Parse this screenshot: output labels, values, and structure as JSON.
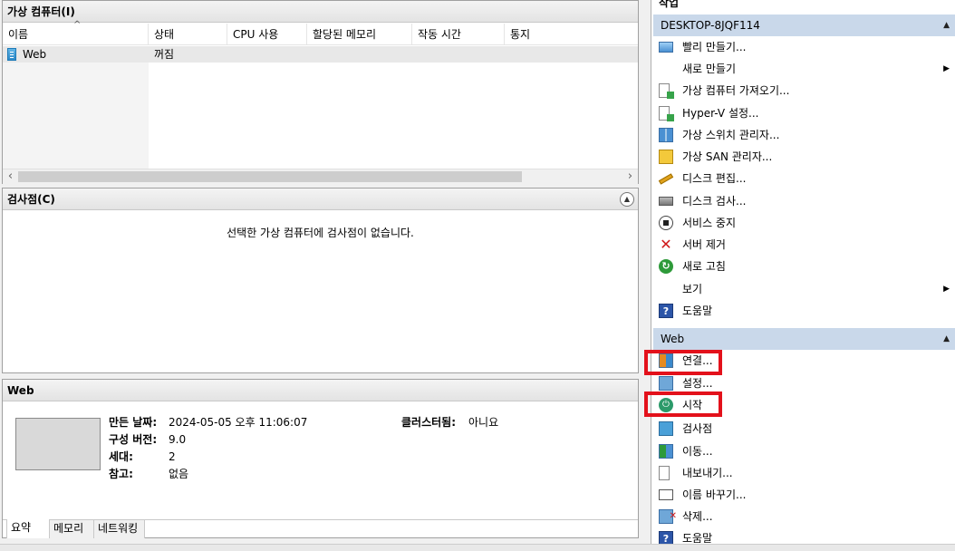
{
  "vm_panel": {
    "title": "가상 컴퓨터(I)",
    "columns": [
      "이름",
      "상태",
      "CPU 사용",
      "할당된 메모리",
      "작동 시간",
      "통지"
    ],
    "rows": [
      {
        "name": "Web",
        "state": "꺼짐"
      }
    ]
  },
  "checkpoint_panel": {
    "title": "검사점(C)",
    "empty_message": "선택한 가상 컴퓨터에 검사점이 없습니다."
  },
  "detail_panel": {
    "title": "Web",
    "created_label": "만든 날짜:",
    "created_value": "2024-05-05 오후 11:06:07",
    "config_label": "구성 버전:",
    "config_value": "9.0",
    "generation_label": "세대:",
    "generation_value": "2",
    "notes_label": "참고:",
    "notes_value": "없음",
    "clustered_label": "클러스터됨:",
    "clustered_value": "아니요",
    "tabs": [
      "요약",
      "메모리",
      "네트워킹"
    ]
  },
  "actions": {
    "title": "작업",
    "host_section": {
      "title": "DESKTOP-8JQF114",
      "items": [
        {
          "label": "빨리 만들기...",
          "icon": "quick-create-icon"
        },
        {
          "label": "새로 만들기",
          "icon": "none",
          "submenu": true
        },
        {
          "label": "가상 컴퓨터 가져오기...",
          "icon": "import-vm-icon"
        },
        {
          "label": "Hyper-V 설정...",
          "icon": "hyperv-settings-icon"
        },
        {
          "label": "가상 스위치 관리자...",
          "icon": "virtual-switch-icon"
        },
        {
          "label": "가상 SAN 관리자...",
          "icon": "virtual-san-icon"
        },
        {
          "label": "디스크 편집...",
          "icon": "edit-disk-icon"
        },
        {
          "label": "디스크 검사...",
          "icon": "inspect-disk-icon"
        },
        {
          "label": "서비스 중지",
          "icon": "stop-service-icon"
        },
        {
          "label": "서버 제거",
          "icon": "remove-server-icon"
        },
        {
          "label": "새로 고침",
          "icon": "refresh-icon"
        },
        {
          "label": "보기",
          "icon": "none",
          "submenu": true
        },
        {
          "label": "도움말",
          "icon": "help-icon"
        }
      ]
    },
    "vm_section": {
      "title": "Web",
      "items": [
        {
          "label": "연결...",
          "icon": "connect-icon",
          "highlighted": true
        },
        {
          "label": "설정...",
          "icon": "vm-settings-icon"
        },
        {
          "label": "시작",
          "icon": "start-icon",
          "highlighted": true
        },
        {
          "label": "검사점",
          "icon": "checkpoint-icon"
        },
        {
          "label": "이동...",
          "icon": "move-icon"
        },
        {
          "label": "내보내기...",
          "icon": "export-icon"
        },
        {
          "label": "이름 바꾸기...",
          "icon": "rename-icon"
        },
        {
          "label": "삭제...",
          "icon": "delete-icon"
        },
        {
          "label": "도움말",
          "icon": "help-icon"
        }
      ]
    },
    "highlight_color": "#e3111b",
    "section_color": "#c9d8ea"
  }
}
